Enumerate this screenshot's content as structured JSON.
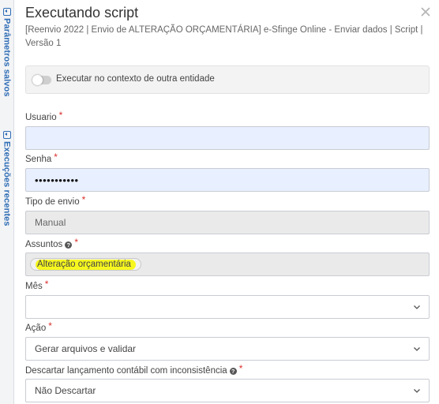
{
  "rail": {
    "tab_saved_params": "Parâmetros salvos",
    "tab_recent_runs": "Execuções recentes"
  },
  "modal": {
    "title": "Executando script",
    "subtitle": "[Reenvio 2022 | Envio de ALTERAÇÃO ORÇAMENTÁRIA] e-Sfinge Online - Enviar dados | Script | Versão 1",
    "context_toggle_label": "Executar no contexto de outra entidade",
    "context_toggle_on": false
  },
  "form": {
    "usuario": {
      "label": "Usuario",
      "required_mark": "*",
      "value": ""
    },
    "senha": {
      "label": "Senha",
      "required_mark": "*",
      "value": "•••••••••••"
    },
    "tipo_envio": {
      "label": "Tipo de envio",
      "required_mark": "*",
      "value": "Manual"
    },
    "assuntos": {
      "label": "Assuntos",
      "help_icon": "?",
      "required_mark": "*",
      "chip": "Alteração orçamentária"
    },
    "mes": {
      "label": "Mês",
      "required_mark": "*",
      "value": ""
    },
    "acao": {
      "label": "Ação",
      "required_mark": "*",
      "value": "Gerar arquivos e validar"
    },
    "descartar": {
      "label": "Descartar lançamento contábil com inconsistência",
      "help_icon": "?",
      "required_mark": "*",
      "value": "Não Descartar"
    }
  },
  "colors": {
    "accent": "#2f6db5",
    "required": "#d9302c",
    "autofill_bg": "#e8effe",
    "highlight": "#f7f71f"
  },
  "icons": [
    "panel-toggle-icon",
    "close-icon",
    "help-icon",
    "chevron-down-icon"
  ]
}
